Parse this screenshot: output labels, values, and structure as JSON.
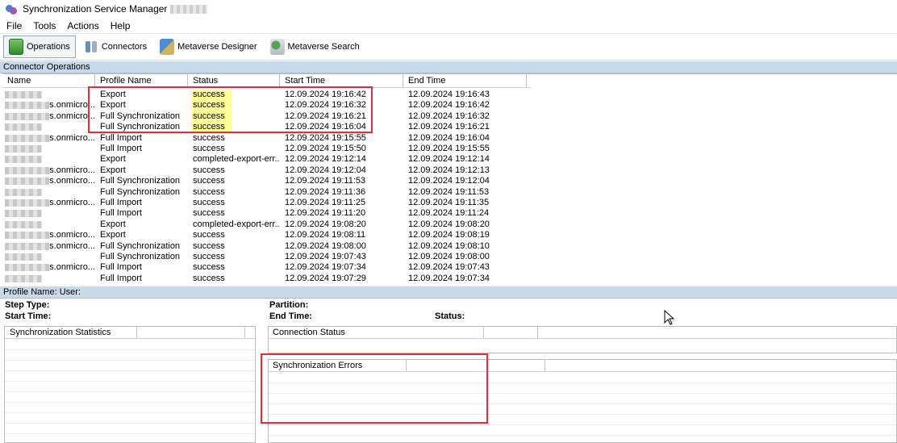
{
  "window": {
    "title": "Synchronization Service Manager"
  },
  "menu": [
    "File",
    "Tools",
    "Actions",
    "Help"
  ],
  "toolbar": [
    {
      "label": "Operations",
      "icon": "operations-icon",
      "active": true
    },
    {
      "label": "Connectors",
      "icon": "connectors-icon"
    },
    {
      "label": "Metaverse Designer",
      "icon": "metaverse-designer-icon"
    },
    {
      "label": "Metaverse Search",
      "icon": "metaverse-search-icon"
    }
  ],
  "operations": {
    "section_title": "Connector Operations",
    "columns": [
      "Name",
      "Profile Name",
      "Status",
      "Start Time",
      "End Time"
    ],
    "name_suffix": "s.onmicro...",
    "rows": [
      {
        "profile": "Export",
        "status": "success",
        "start": "12.09.2024 19:16:42",
        "end": "12.09.2024 19:16:43",
        "suffix": false,
        "highlight": true
      },
      {
        "profile": "Export",
        "status": "success",
        "start": "12.09.2024 19:16:32",
        "end": "12.09.2024 19:16:42",
        "suffix": true,
        "highlight": true
      },
      {
        "profile": "Full Synchronization",
        "status": "success",
        "start": "12.09.2024 19:16:21",
        "end": "12.09.2024 19:16:32",
        "suffix": true,
        "highlight": true
      },
      {
        "profile": "Full Synchronization",
        "status": "success",
        "start": "12.09.2024 19:16:04",
        "end": "12.09.2024 19:16:21",
        "suffix": false,
        "highlight": true
      },
      {
        "profile": "Full Import",
        "status": "success",
        "start": "12.09.2024 19:15:55",
        "end": "12.09.2024 19:16:04",
        "suffix": true,
        "highlight": false
      },
      {
        "profile": "Full Import",
        "status": "success",
        "start": "12.09.2024 19:15:50",
        "end": "12.09.2024 19:15:55",
        "suffix": false,
        "highlight": false
      },
      {
        "profile": "Export",
        "status": "completed-export-err...",
        "start": "12.09.2024 19:12:14",
        "end": "12.09.2024 19:12:14",
        "suffix": false,
        "highlight": false
      },
      {
        "profile": "Export",
        "status": "success",
        "start": "12.09.2024 19:12:04",
        "end": "12.09.2024 19:12:13",
        "suffix": true,
        "highlight": false
      },
      {
        "profile": "Full Synchronization",
        "status": "success",
        "start": "12.09.2024 19:11:53",
        "end": "12.09.2024 19:12:04",
        "suffix": true,
        "highlight": false
      },
      {
        "profile": "Full Synchronization",
        "status": "success",
        "start": "12.09.2024 19:11:36",
        "end": "12.09.2024 19:11:53",
        "suffix": false,
        "highlight": false
      },
      {
        "profile": "Full Import",
        "status": "success",
        "start": "12.09.2024 19:11:25",
        "end": "12.09.2024 19:11:35",
        "suffix": true,
        "highlight": false
      },
      {
        "profile": "Full Import",
        "status": "success",
        "start": "12.09.2024 19:11:20",
        "end": "12.09.2024 19:11:24",
        "suffix": false,
        "highlight": false
      },
      {
        "profile": "Export",
        "status": "completed-export-err...",
        "start": "12.09.2024 19:08:20",
        "end": "12.09.2024 19:08:20",
        "suffix": false,
        "highlight": false
      },
      {
        "profile": "Export",
        "status": "success",
        "start": "12.09.2024 19:08:11",
        "end": "12.09.2024 19:08:19",
        "suffix": true,
        "highlight": false
      },
      {
        "profile": "Full Synchronization",
        "status": "success",
        "start": "12.09.2024 19:08:00",
        "end": "12.09.2024 19:08:10",
        "suffix": true,
        "highlight": false
      },
      {
        "profile": "Full Synchronization",
        "status": "success",
        "start": "12.09.2024 19:07:43",
        "end": "12.09.2024 19:08:00",
        "suffix": false,
        "highlight": false
      },
      {
        "profile": "Full Import",
        "status": "success",
        "start": "12.09.2024 19:07:34",
        "end": "12.09.2024 19:07:43",
        "suffix": true,
        "highlight": false
      },
      {
        "profile": "Full Import",
        "status": "success",
        "start": "12.09.2024 19:07:29",
        "end": "12.09.2024 19:07:34",
        "suffix": false,
        "highlight": false
      }
    ]
  },
  "details": {
    "header": "Profile Name:   User:",
    "step_type": "Step Type:",
    "start_time": "Start Time:",
    "partition": "Partition:",
    "end_time": "End Time:",
    "status": "Status:",
    "sync_stats": "Synchronization Statistics",
    "connection_status": "Connection Status",
    "sync_errors": "Synchronization Errors"
  },
  "colors": {
    "highlight": "#ffff99",
    "annotation": "#e0303a",
    "section": "#c9d9ea"
  }
}
